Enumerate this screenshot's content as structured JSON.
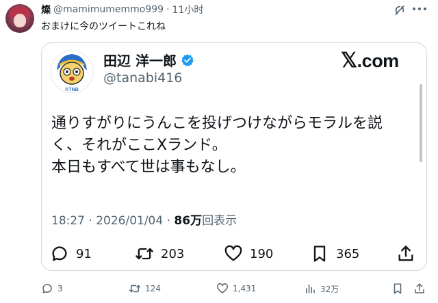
{
  "post": {
    "display_name": "燦",
    "handle": "@mamimumemmo999",
    "separator": "·",
    "time": "11小时",
    "text": "おまけに今のツイートこれね"
  },
  "quoted": {
    "name": "田辺 洋一郎",
    "handle": "@tanabi416",
    "avatar_badge": "©TNB",
    "brand_x": "𝕏",
    "brand_domain": ".com",
    "body_lines": [
      "通りすがりにうんこを投げつけながらモラルを説",
      "く、それがここXランド。",
      "本日もすべて世は事もなし。"
    ],
    "meta_time": "18:27 · 2026/01/04 · ",
    "meta_views_count": "86万",
    "meta_views_label": "回表示",
    "actions": {
      "replies": "91",
      "reposts": "203",
      "likes": "190",
      "bookmarks": "365"
    }
  },
  "footer": {
    "replies": "3",
    "reposts": "124",
    "likes": "1,431",
    "views": "32万"
  },
  "colors": {
    "text_primary": "#0f1419",
    "text_secondary": "#536471",
    "border": "#cfd9de",
    "verified": "#1d9bf0"
  }
}
